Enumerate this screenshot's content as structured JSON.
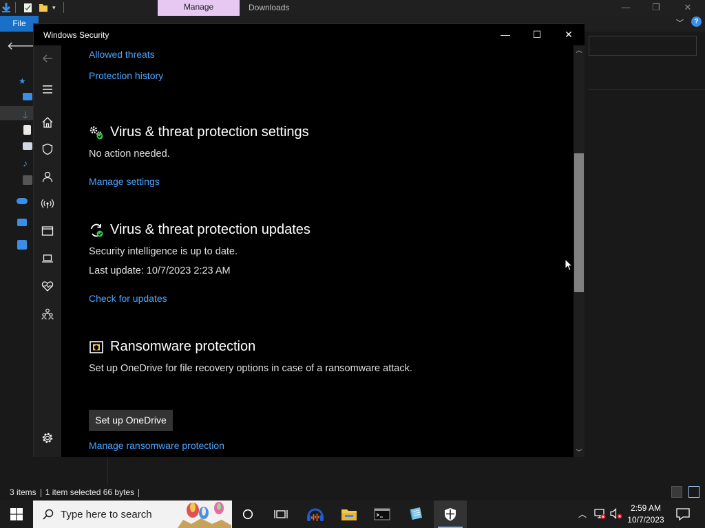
{
  "explorer": {
    "ribbon_tab_manage": "Manage",
    "window_title": "Downloads",
    "file_tab": "File",
    "status": {
      "items": "3 items",
      "selected": "1 item selected  66 bytes"
    }
  },
  "security": {
    "window_title": "Windows Security",
    "links_top": {
      "allowed_threats": "Allowed threats",
      "protection_history": "Protection history"
    },
    "settings_section": {
      "heading": "Virus & threat protection settings",
      "status": "No action needed.",
      "link": "Manage settings"
    },
    "updates_section": {
      "heading": "Virus & threat protection updates",
      "status": "Security intelligence is up to date.",
      "last_update": "Last update: 10/7/2023 2:23 AM",
      "link": "Check for updates"
    },
    "ransomware_section": {
      "heading": "Ransomware protection",
      "description": "Set up OneDrive for file recovery options in case of a ransomware attack.",
      "button": "Set up OneDrive",
      "link": "Manage ransomware protection"
    },
    "nav_icons": [
      "back-icon",
      "hamburger-icon",
      "home-icon",
      "shield-icon",
      "account-icon",
      "firewall-icon",
      "app-browser-icon",
      "device-security-icon",
      "health-icon",
      "family-icon",
      "settings-icon"
    ]
  },
  "taskbar": {
    "search_placeholder": "Type here to search",
    "clock_time": "2:59 AM",
    "clock_date": "10/7/2023",
    "apps": [
      "cortana-icon",
      "task-view-icon",
      "audacity-icon",
      "file-explorer-icon",
      "terminal-icon",
      "notepad-icon",
      "windows-security-icon"
    ]
  },
  "colors": {
    "link": "#4ca5ff",
    "accent_blue": "#1a70c7",
    "manage_tab": "#e6c8f2",
    "ok_green": "#2ecc40"
  }
}
